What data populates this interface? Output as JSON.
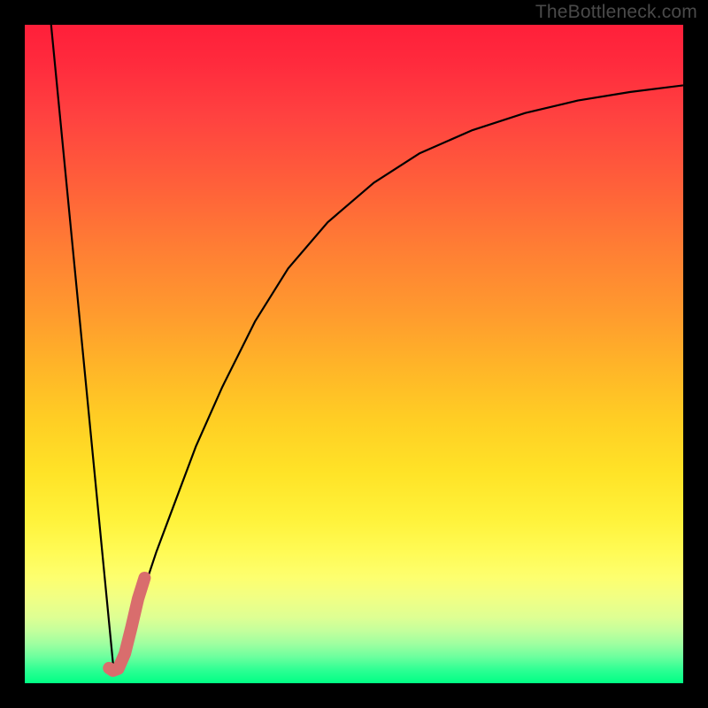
{
  "watermark": "TheBottleneck.com",
  "chart_data": {
    "type": "line",
    "title": "",
    "xlabel": "",
    "ylabel": "",
    "xlim": [
      0,
      100
    ],
    "ylim": [
      0,
      100
    ],
    "grid": false,
    "series": [
      {
        "name": "left-line",
        "color": "#000000",
        "width": 2.2,
        "x": [
          4,
          13.5
        ],
        "values": [
          100,
          2
        ]
      },
      {
        "name": "right-curve",
        "color": "#000000",
        "width": 2.2,
        "x": [
          13.5,
          16,
          18,
          20,
          23,
          26,
          30,
          35,
          40,
          46,
          53,
          60,
          68,
          76,
          84,
          92,
          100
        ],
        "values": [
          2,
          8,
          14,
          20,
          28,
          36,
          45,
          55,
          63,
          70,
          76,
          80.5,
          84,
          86.6,
          88.5,
          89.8,
          90.8
        ]
      },
      {
        "name": "pink-j-accent",
        "color": "#d96d6d",
        "width": 14,
        "linecap": "round",
        "x": [
          12.8,
          13.4,
          14.2,
          15.2,
          16.2,
          17.2,
          18.2
        ],
        "values": [
          2.3,
          1.9,
          2.2,
          4.5,
          8.5,
          12.8,
          16.0
        ]
      }
    ],
    "background_gradient": {
      "type": "vertical",
      "stops": [
        {
          "pos": 0.0,
          "color": "#ff1f3a"
        },
        {
          "pos": 0.5,
          "color": "#ffb528"
        },
        {
          "pos": 0.78,
          "color": "#fff640"
        },
        {
          "pos": 1.0,
          "color": "#00ff85"
        }
      ]
    }
  }
}
